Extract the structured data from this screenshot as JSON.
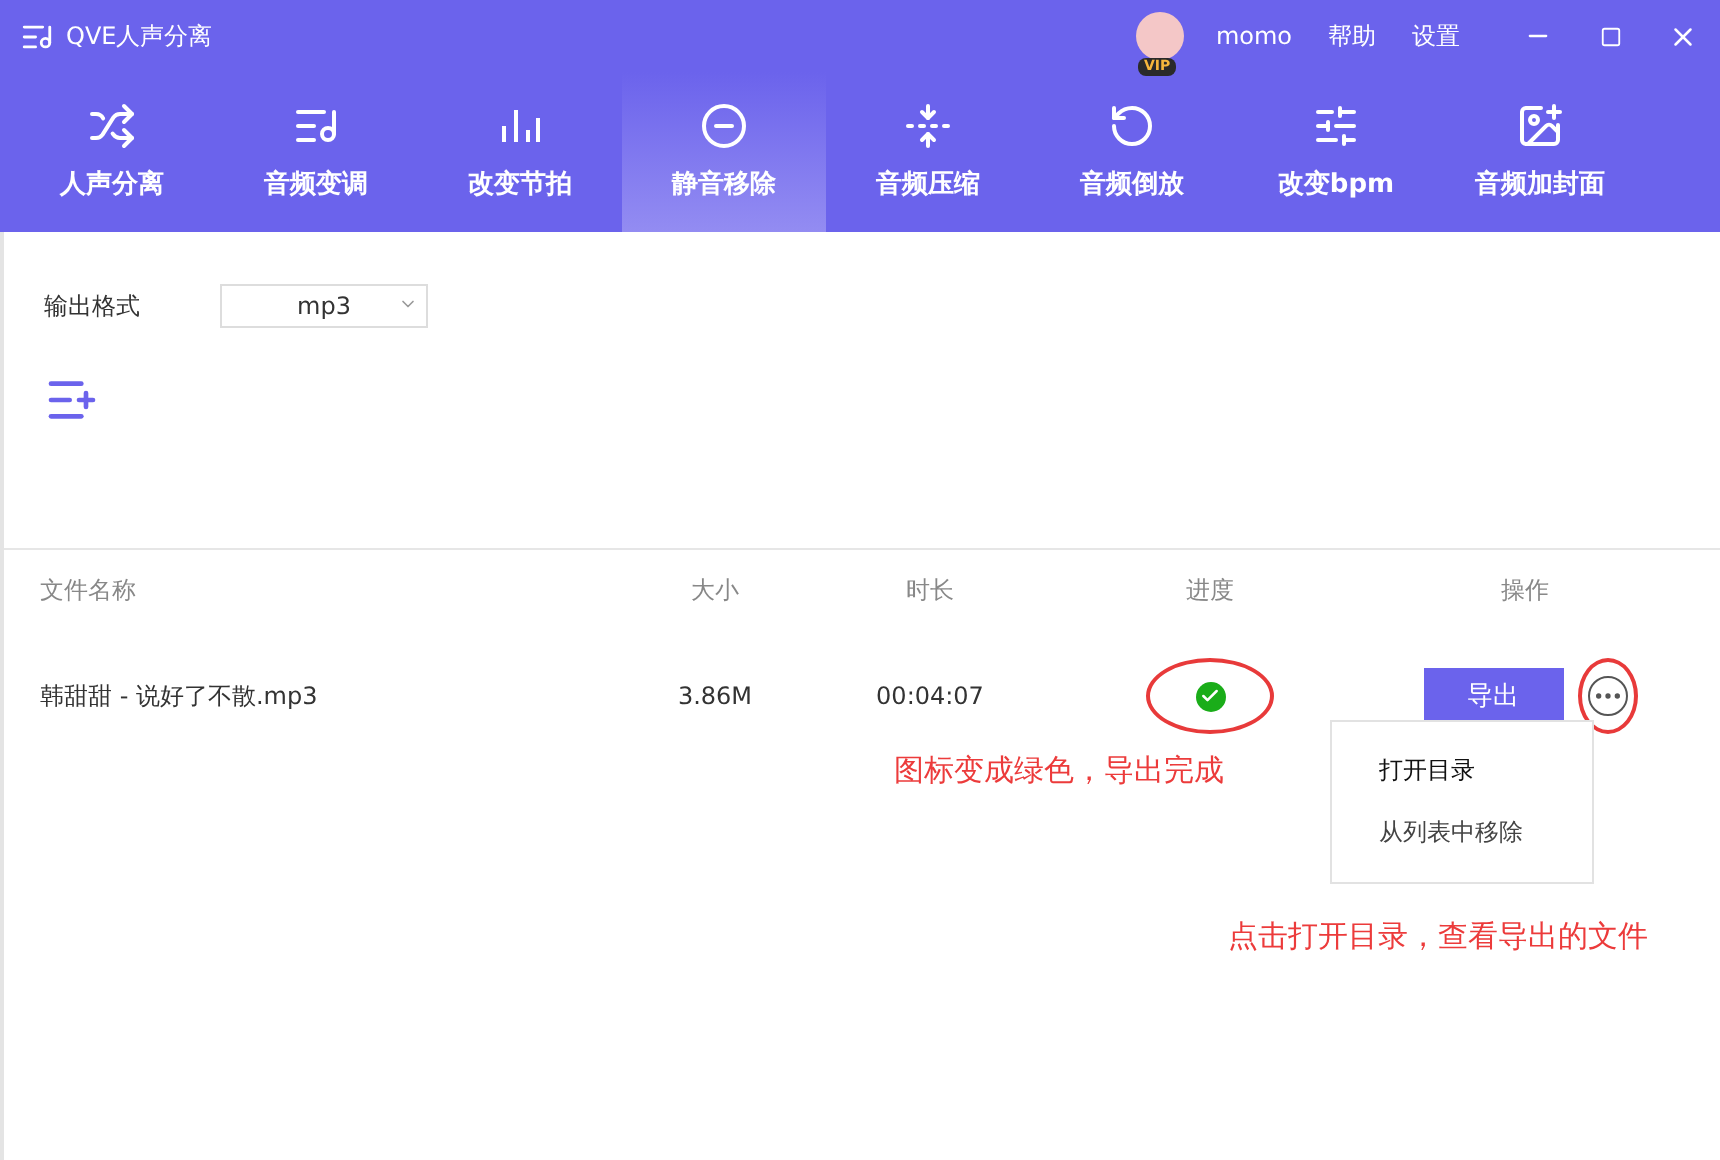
{
  "window": {
    "title": "QVE人声分离"
  },
  "user": {
    "name": "momo",
    "badge": "VIP"
  },
  "menu_links": [
    "帮助",
    "设置"
  ],
  "tabs": [
    {
      "label": "人声分离",
      "selected": false
    },
    {
      "label": "音频变调",
      "selected": false
    },
    {
      "label": "改变节拍",
      "selected": false
    },
    {
      "label": "静音移除",
      "selected": true
    },
    {
      "label": "音频压缩",
      "selected": false
    },
    {
      "label": "音频倒放",
      "selected": false
    },
    {
      "label": "改变bpm",
      "selected": false
    },
    {
      "label": "音频加封面",
      "selected": false
    }
  ],
  "output_format": {
    "label": "输出格式",
    "value": "mp3"
  },
  "table": {
    "columns": [
      "文件名称",
      "大小",
      "时长",
      "进度",
      "操作"
    ],
    "rows": [
      {
        "name": "韩甜甜 - 说好了不散.mp3",
        "size": "3.86M",
        "duration": "00:04:07",
        "done": true,
        "action": "导出"
      }
    ]
  },
  "context_menu": [
    "打开目录",
    "从列表中移除"
  ],
  "annotations": [
    "图标变成绿色，导出完成",
    "点击打开目录，查看导出的文件"
  ]
}
